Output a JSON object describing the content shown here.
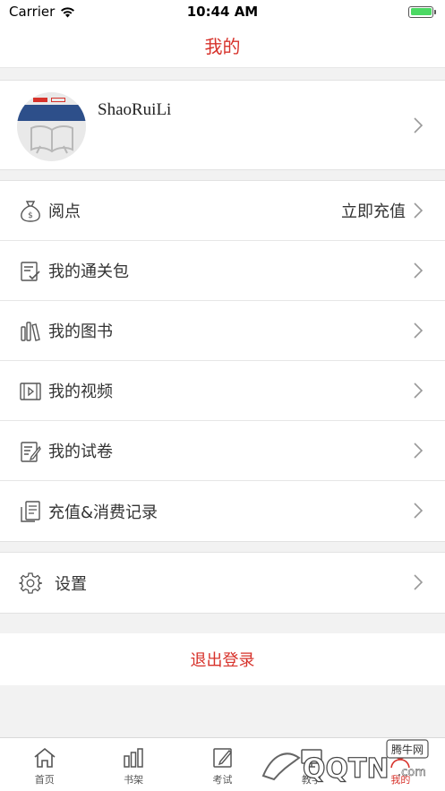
{
  "status_bar": {
    "carrier": "Carrier",
    "time": "10:44 AM",
    "battery_level": 1.0
  },
  "nav": {
    "title": "我的"
  },
  "profile": {
    "username": "ShaoRuiLi"
  },
  "menu": [
    {
      "icon": "money-bag-icon",
      "label": "阅点",
      "right_text": "立即充值"
    },
    {
      "icon": "pass-package-icon",
      "label": "我的通关包",
      "right_text": ""
    },
    {
      "icon": "books-icon",
      "label": "我的图书",
      "right_text": ""
    },
    {
      "icon": "video-icon",
      "label": "我的视频",
      "right_text": ""
    },
    {
      "icon": "exam-paper-icon",
      "label": "我的试卷",
      "right_text": ""
    },
    {
      "icon": "receipt-icon",
      "label": "充值&消费记录",
      "right_text": ""
    }
  ],
  "settings": {
    "icon": "gear-icon",
    "label": "设置"
  },
  "logout": {
    "label": "退出登录"
  },
  "tabs": [
    {
      "icon": "home-icon",
      "label": "首页",
      "active": false
    },
    {
      "icon": "bookshelf-icon",
      "label": "书架",
      "active": false
    },
    {
      "icon": "exam-icon",
      "label": "考试",
      "active": false
    },
    {
      "icon": "teaching-icon",
      "label": "教学",
      "active": false
    },
    {
      "icon": "me-icon",
      "label": "我的",
      "active": true
    }
  ],
  "watermark": {
    "brand": "QQTN",
    "suffix": ".com",
    "badge": "腾牛网"
  },
  "colors": {
    "accent": "#d7322b",
    "background": "#f2f2f2",
    "battery": "#4cd964"
  }
}
